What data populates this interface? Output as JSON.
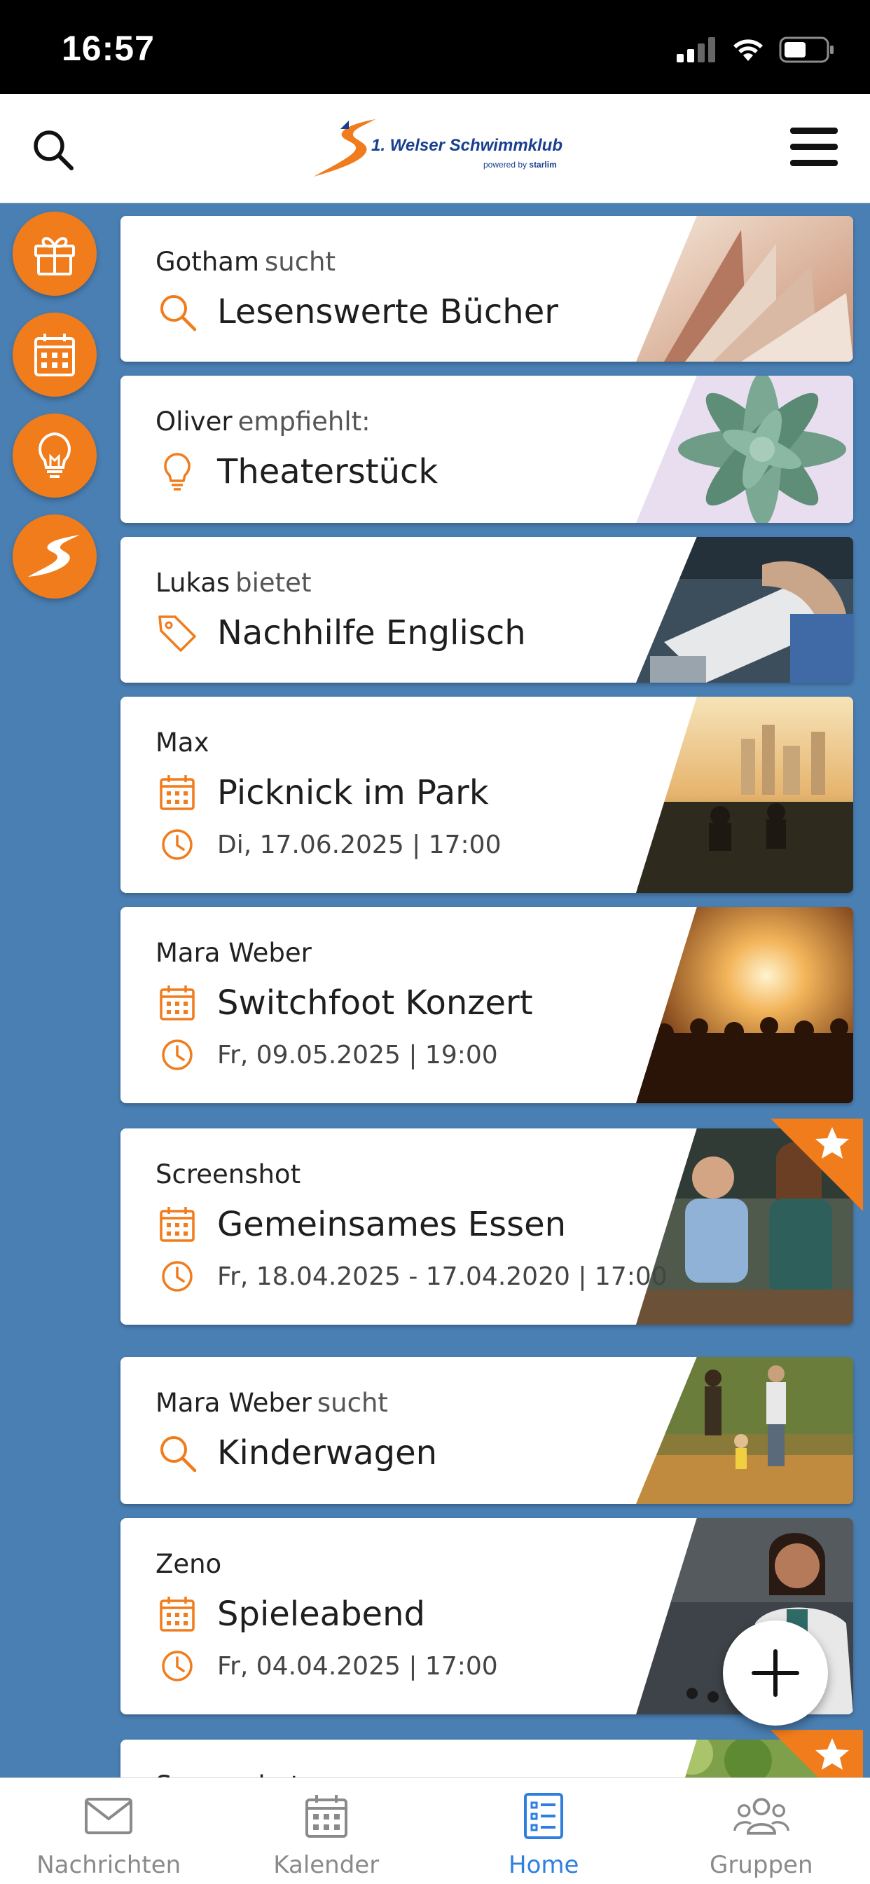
{
  "status": {
    "time": "16:57"
  },
  "header": {
    "logo_text": "1. Welser Schwimmklub",
    "logo_sub_prefix": "powered by",
    "logo_sub_brand": "starlim"
  },
  "colors": {
    "accent": "#f07c1c",
    "background": "#4a7fb3",
    "active_nav": "#2f7fe0"
  },
  "side_buttons": [
    {
      "icon": "gift-icon"
    },
    {
      "icon": "calendar-icon"
    },
    {
      "icon": "lightbulb-icon"
    },
    {
      "icon": "club-logo-icon"
    }
  ],
  "cards": [
    {
      "author": "Gotham",
      "action": "sucht",
      "icon": "search-icon",
      "title": "Lesenswerte Bücher",
      "image": "open book"
    },
    {
      "author": "Oliver",
      "action": "empfiehlt:",
      "icon": "lightbulb-icon",
      "title": "Theaterstück",
      "image": "succulent plant"
    },
    {
      "author": "Lukas",
      "action": "bietet",
      "icon": "tag-icon",
      "title": "Nachhilfe Englisch",
      "image": "writing at desk"
    },
    {
      "author": "Max",
      "action": "",
      "icon": "calendar-icon",
      "title": "Picknick im Park",
      "date": "Di, 17.06.2025 | 17:00",
      "image": "picnic skyline"
    },
    {
      "author": "Mara Weber",
      "action": "",
      "icon": "calendar-icon",
      "title": "Switchfoot Konzert",
      "date": "Fr, 09.05.2025 | 19:00",
      "image": "concert crowd"
    },
    {
      "author": "Screenshot",
      "action": "",
      "icon": "calendar-icon",
      "title": "Gemeinsames Essen",
      "date": "Fr, 18.04.2025 - 17.04.2020 | 17:00",
      "image": "friends at cafe",
      "starred": true
    },
    {
      "author": "Mara Weber",
      "action": "sucht",
      "icon": "search-icon",
      "title": "Kinderwagen",
      "image": "family walk"
    },
    {
      "author": "Zeno",
      "action": "",
      "icon": "calendar-icon",
      "title": "Spieleabend",
      "date": "Fr, 04.04.2025 | 17:00",
      "image": "smiling woman"
    },
    {
      "author": "Screenshot",
      "action": "",
      "icon": "",
      "title": "",
      "image": "plants",
      "starred": true
    }
  ],
  "fab": {
    "icon": "plus-icon"
  },
  "bottom_nav": [
    {
      "label": "Nachrichten",
      "icon": "mail-icon",
      "active": false
    },
    {
      "label": "Kalender",
      "icon": "calendar-icon",
      "active": false
    },
    {
      "label": "Home",
      "icon": "list-icon",
      "active": true
    },
    {
      "label": "Gruppen",
      "icon": "group-icon",
      "active": false
    }
  ]
}
